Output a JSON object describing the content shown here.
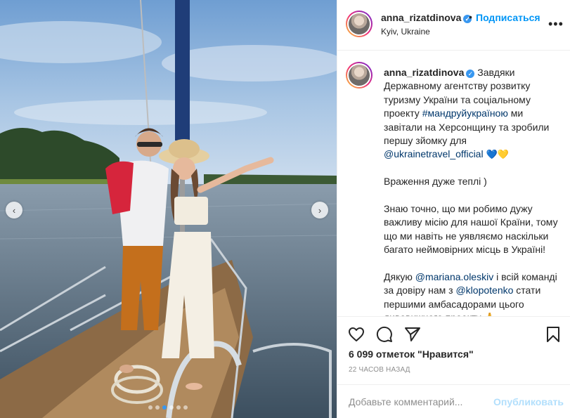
{
  "post": {
    "username": "anna_rizatdinova",
    "header_separator": "•",
    "follow_label": "Подписаться",
    "location": "Kyiv, Ukraine",
    "more_icon": "more-horizontal-icon"
  },
  "caption": {
    "username": "anna_rizatdinova",
    "p1_a": "Завдяки Державному агентству розвитку туризму України та соціальному проекту ",
    "p1_hashtag": "#мандруйукраїною",
    "p1_b": " ми завітали на Херсонщину та зробили першу зйомку для ",
    "p1_mention": "@ukrainetravel_official",
    "p1_hearts": "💙💛",
    "p2": "Враження дуже теплі )",
    "p3": "Знаю точно, що ми робимо дужу важливу місію для нашої Країни, тому що ми навіть не уявляємо наскільки багато неймовірних місць в Україні!",
    "p4_a": "Дякую ",
    "p4_mention1": "@mariana.oleskiv",
    "p4_b": " і всій команді за довіру нам з ",
    "p4_mention2": "@klopotenko",
    "p4_c": " стати першими амбасадорами цього дивовижного проекту 🙏"
  },
  "actions": {
    "likes": "6 099 отметок \"Нравится\"",
    "time": "22 ЧАСОВ НАЗАД",
    "comment_placeholder": "Добавьте комментарий...",
    "publish_label": "Опубликовать"
  },
  "carousel": {
    "left_arrow": "‹",
    "right_arrow": "›",
    "slide_count": 6,
    "active_index": 3
  },
  "colors": {
    "link": "#0095f6",
    "tag": "#00376b",
    "muted": "#8e8e8e",
    "active_dot": "#3897f0"
  }
}
